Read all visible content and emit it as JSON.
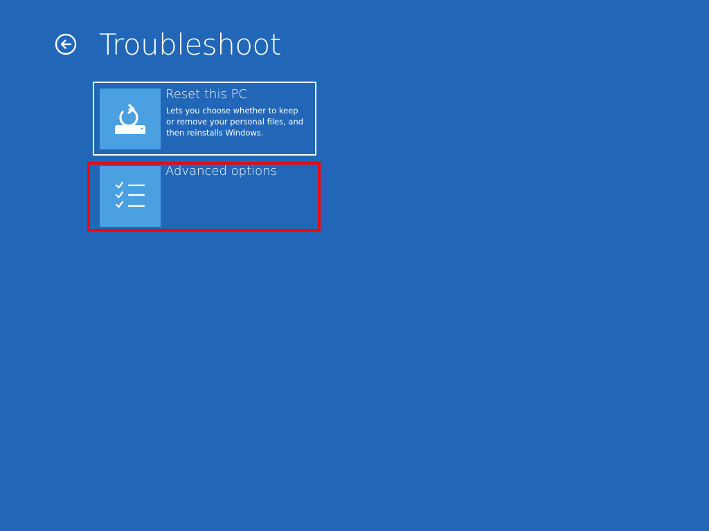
{
  "page": {
    "title": "Troubleshoot"
  },
  "options": [
    {
      "title": "Reset this PC",
      "description": "Lets you choose whether to keep or remove your personal files, and then reinstalls Windows.",
      "icon": "reset-pc-icon"
    },
    {
      "title": "Advanced options",
      "description": "",
      "icon": "checklist-icon"
    }
  ],
  "colors": {
    "background": "#2267b7",
    "tile_icon_bg": "#4aa0e1",
    "text": "#ffffff",
    "highlight": "#ff0000"
  }
}
